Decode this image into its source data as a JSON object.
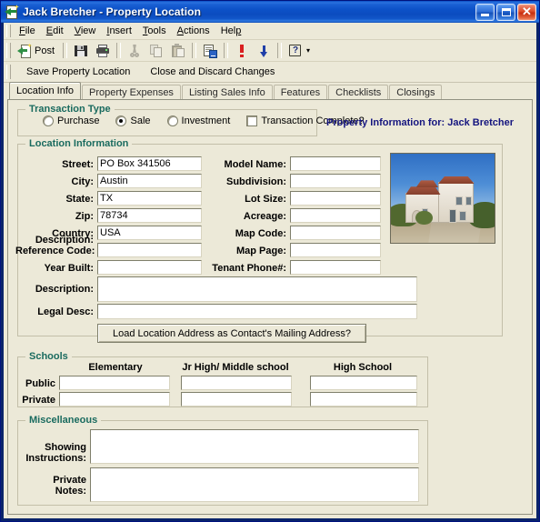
{
  "window": {
    "title": "Jack Bretcher - Property Location",
    "icon": "post-document-icon",
    "controls": {
      "minimize": "Minimize",
      "maximize": "Maximize",
      "close": "Close"
    }
  },
  "menubar": {
    "items": [
      {
        "label": "File",
        "accel": "F"
      },
      {
        "label": "Edit",
        "accel": "E"
      },
      {
        "label": "View",
        "accel": "V"
      },
      {
        "label": "Insert",
        "accel": "I"
      },
      {
        "label": "Tools",
        "accel": "T"
      },
      {
        "label": "Actions",
        "accel": "A"
      },
      {
        "label": "Help",
        "accel": "H"
      }
    ]
  },
  "toolbar": {
    "post_label": "Post",
    "buttons": [
      {
        "name": "post-button",
        "icon": "post-icon",
        "label": "Post",
        "enabled": true
      },
      {
        "name": "save-button",
        "icon": "save-floppy-icon",
        "label": "",
        "enabled": true
      },
      {
        "name": "print-button",
        "icon": "printer-icon",
        "label": "",
        "enabled": true
      },
      {
        "name": "cut-button",
        "icon": "scissors-icon",
        "label": "",
        "enabled": false
      },
      {
        "name": "copy-button",
        "icon": "copy-icon",
        "label": "",
        "enabled": false
      },
      {
        "name": "paste-button",
        "icon": "paste-icon",
        "label": "",
        "enabled": false
      },
      {
        "name": "print-preview-button",
        "icon": "print-preview-icon",
        "label": "",
        "enabled": true
      },
      {
        "name": "priority-button",
        "icon": "exclamation-icon",
        "label": "",
        "enabled": true
      },
      {
        "name": "move-down-button",
        "icon": "down-arrow-icon",
        "label": "",
        "enabled": true
      },
      {
        "name": "help-button",
        "icon": "question-mark-icon",
        "label": "",
        "enabled": true
      }
    ]
  },
  "actionbar": {
    "save": "Save Property Location",
    "close": "Close and Discard Changes"
  },
  "tabs": [
    {
      "label": "Location Info",
      "active": true
    },
    {
      "label": "Property Expenses",
      "active": false
    },
    {
      "label": "Listing Sales Info",
      "active": false
    },
    {
      "label": "Features",
      "active": false
    },
    {
      "label": "Checklists",
      "active": false
    },
    {
      "label": "Closings",
      "active": false
    }
  ],
  "transaction_type": {
    "title": "Transaction Type",
    "options": [
      {
        "label": "Purchase",
        "selected": false
      },
      {
        "label": "Sale",
        "selected": true
      },
      {
        "label": "Investment",
        "selected": false
      }
    ],
    "complete_checkbox": {
      "label": "Transaction Complete?",
      "checked": false
    }
  },
  "property_info_heading": "Property Information for: Jack Bretcher",
  "location_information": {
    "title": "Location Information",
    "left_fields": [
      {
        "label": "Street:",
        "value": "PO Box 341506"
      },
      {
        "label": "City:",
        "value": "Austin"
      },
      {
        "label": "State:",
        "value": "TX"
      },
      {
        "label": "Zip:",
        "value": "78734"
      },
      {
        "label": "Country:",
        "value": "USA"
      },
      {
        "label": "Reference Code:",
        "value": ""
      },
      {
        "label": "Year Built:",
        "value": ""
      }
    ],
    "right_fields": [
      {
        "label": "Model Name:",
        "value": ""
      },
      {
        "label": "Subdivision:",
        "value": ""
      },
      {
        "label": "Lot Size:",
        "value": ""
      },
      {
        "label": "Acreage:",
        "value": ""
      },
      {
        "label": "Map Code:",
        "value": ""
      },
      {
        "label": "Map Page:",
        "value": ""
      },
      {
        "label": "Tenant Phone#:",
        "value": ""
      }
    ],
    "description": {
      "label": "Description:",
      "value": ""
    },
    "legal_desc": {
      "label": "Legal Desc:",
      "value": ""
    },
    "load_address_button": "Load Location Address as Contact's Mailing Address?",
    "photo_alt": "property-photo"
  },
  "schools": {
    "title": "Schools",
    "columns": [
      "Elementary",
      "Jr High/ Middle school",
      "High School"
    ],
    "rows": [
      {
        "label": "Public",
        "values": [
          "",
          "",
          ""
        ]
      },
      {
        "label": "Private",
        "values": [
          "",
          "",
          ""
        ]
      }
    ]
  },
  "miscellaneous": {
    "title": "Miscellaneous",
    "showing_instructions": {
      "label_line1": "Showing",
      "label_line2": "Instructions:",
      "value": ""
    },
    "private_notes": {
      "label_line1": "Private",
      "label_line2": "Notes:",
      "value": ""
    }
  },
  "colors": {
    "titlebar_blue": "#0d52c8",
    "window_border": "#00137f",
    "face": "#ece9d8",
    "groupbox_title": "#1a6b5f",
    "heading_navy": "#15157f",
    "field_white": "#ffffff"
  }
}
